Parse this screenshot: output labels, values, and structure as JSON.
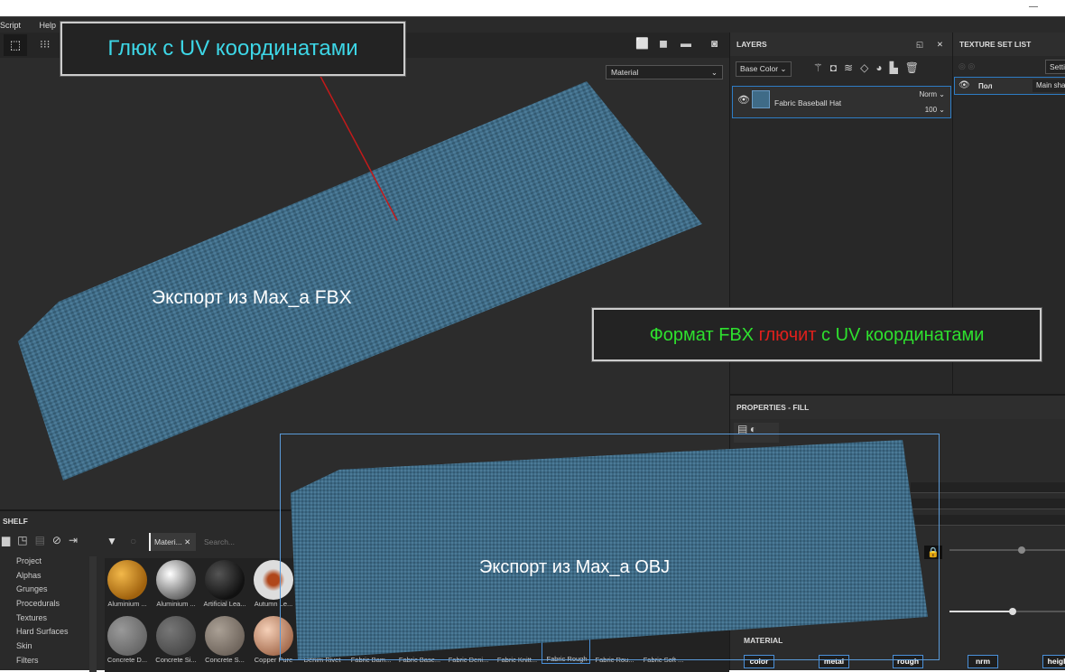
{
  "menu": [
    "Script",
    "Help"
  ],
  "viewport": {
    "mode": "Material",
    "annotation_top": "Глюк с UV координатами",
    "label_fbx": "Экспорт из Max_a  FBX",
    "label_obj": "Экспорт из Max_a  OBJ",
    "note": {
      "part1": "Формат  FBX ",
      "part2": "глючит",
      "part3": " с UV координатами"
    }
  },
  "layers": {
    "title": "LAYERS",
    "channel": "Base Color",
    "layer": {
      "name": "Fabric Baseball Hat",
      "blend": "Norm",
      "opacity": "100"
    }
  },
  "texture_set_list": {
    "title": "TEXTURE SET LIST",
    "settings": "Setti",
    "item": {
      "name": "Пол",
      "shader": "Main sha"
    }
  },
  "properties": {
    "title": "PROPERTIES - FILL",
    "material_title": "MATERIAL",
    "channels": [
      "color",
      "metal",
      "rough",
      "nrm",
      "heigh"
    ]
  },
  "shelf": {
    "title": "SHELF",
    "filter_tag": "Materi...",
    "search_placeholder": "Search...",
    "categories": [
      "Project",
      "Alphas",
      "Grunges",
      "Procedurals",
      "Textures",
      "Hard Surfaces",
      "Skin",
      "Filters"
    ],
    "row1": [
      "Aluminium ...",
      "Aluminium ...",
      "Artificial Lea...",
      "Autumn Le..."
    ],
    "row2": [
      "Concrete D...",
      "Concrete Si...",
      "Concrete S...",
      "Copper Pure",
      "Denim Rivet",
      "Fabric Bam...",
      "Fabric Base...",
      "Fabric Deni...",
      "Fabric Knitt...",
      "Fabric Rough",
      "Fabric Rou...",
      "Fabric Soft ..."
    ]
  },
  "colors": {
    "fabric": "#3f6b87",
    "accent": "#4a90d9",
    "cyan": "#3dd6e6",
    "green": "#2ee02e",
    "red": "#e0201c"
  }
}
